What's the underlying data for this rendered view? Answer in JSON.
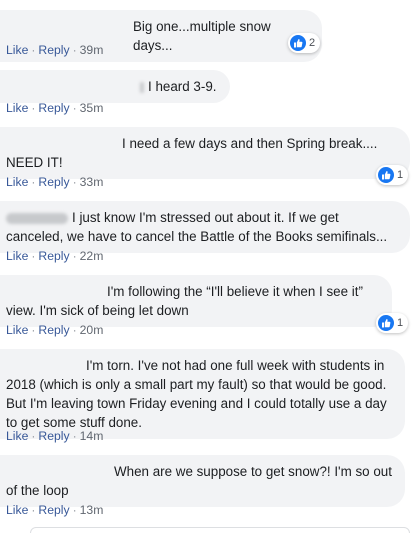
{
  "actions": {
    "like": "Like",
    "reply": "Reply",
    "separator": "·"
  },
  "colors": {
    "bubble": "#f2f3f5",
    "link": "#385898",
    "like_blue": "#1877f2"
  },
  "comments": [
    {
      "text": "Big one...multiple snow days...",
      "time": "39m",
      "reactions": "2"
    },
    {
      "text": "I heard 3-9.",
      "time": "35m"
    },
    {
      "text": "I need a few days and then Spring break.... NEED IT!",
      "time": "33m",
      "reactions": "1"
    },
    {
      "text": "I just know I'm stressed out about it. If we get canceled, we have to cancel the Battle of the Books semifinals...",
      "time": "22m"
    },
    {
      "text": "I'm following the “I'll believe it when I see it” view. I'm sick of being let down",
      "time": "20m",
      "reactions": "1"
    },
    {
      "text": "I'm torn. I've not had one full week with students in 2018 (which is only a small part my fault) so that would be good. But I'm leaving town Friday evening and I could totally use a day to get some stuff done.",
      "time": "14m"
    },
    {
      "text": "When are we suppose to get snow?! I'm so out of the loop",
      "time": "13m"
    }
  ]
}
